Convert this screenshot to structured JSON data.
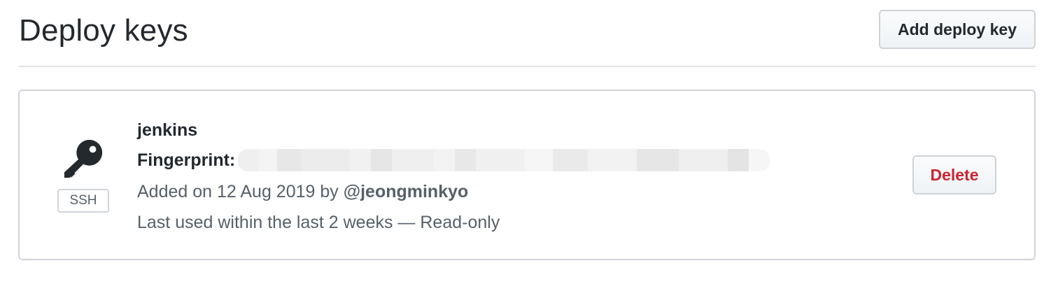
{
  "header": {
    "title": "Deploy keys",
    "add_button_label": "Add deploy key"
  },
  "deploy_key": {
    "icon": "key-icon",
    "type_label": "SSH",
    "name": "jenkins",
    "fingerprint_label": "Fingerprint:",
    "added_prefix": "Added on 12 Aug 2019 by",
    "added_by": "@jeongminkyo",
    "last_used": "Last used within the last 2 weeks — Read-only",
    "delete_label": "Delete"
  },
  "colors": {
    "text_primary": "#24292e",
    "text_secondary": "#586069",
    "danger": "#cb2431",
    "border": "#d1d5da"
  }
}
